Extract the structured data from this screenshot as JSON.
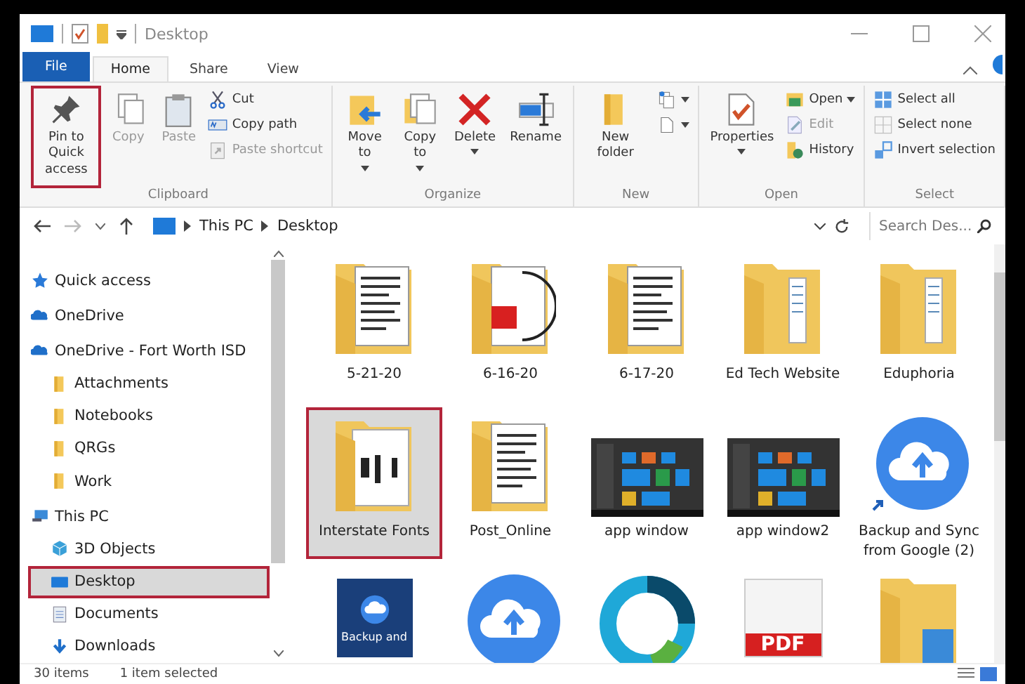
{
  "window": {
    "title": "Desktop"
  },
  "tabs": [
    {
      "label": "File",
      "kind": "file",
      "selected": false
    },
    {
      "label": "Home",
      "kind": "tab",
      "selected": true
    },
    {
      "label": "Share",
      "kind": "tab",
      "selected": false
    },
    {
      "label": "View",
      "kind": "tab",
      "selected": false
    }
  ],
  "ribbon": [
    {
      "label": "Clipboard",
      "items": [
        {
          "kind": "large",
          "label": "Pin to Quick access",
          "disabled": false,
          "outlined": true,
          "dropdown": false
        },
        {
          "kind": "large",
          "label": "Copy",
          "disabled": true,
          "outlined": false,
          "dropdown": false
        },
        {
          "kind": "large",
          "label": "Paste",
          "disabled": true,
          "outlined": false,
          "dropdown": false
        },
        {
          "kind": "stack",
          "entries": [
            {
              "label": "Cut",
              "disabled": false,
              "dropdown": false
            },
            {
              "label": "Copy path",
              "disabled": false,
              "dropdown": false
            },
            {
              "label": "Paste shortcut",
              "disabled": true,
              "dropdown": false
            }
          ]
        }
      ]
    },
    {
      "label": "Organize",
      "items": [
        {
          "kind": "large",
          "label": "Move to",
          "disabled": false,
          "outlined": false,
          "dropdown": true
        },
        {
          "kind": "large",
          "label": "Copy to",
          "disabled": false,
          "outlined": false,
          "dropdown": true
        },
        {
          "kind": "large",
          "label": "Delete",
          "disabled": false,
          "outlined": false,
          "dropdown": true
        },
        {
          "kind": "large",
          "label": "Rename",
          "disabled": false,
          "outlined": false,
          "dropdown": false
        }
      ]
    },
    {
      "label": "New",
      "items": [
        {
          "kind": "large",
          "label": "New folder",
          "disabled": false,
          "outlined": false,
          "dropdown": false
        },
        {
          "kind": "stack",
          "entries": [
            {
              "dropdown": true
            },
            {
              "dropdown": true
            }
          ]
        }
      ]
    },
    {
      "label": "Open",
      "items": [
        {
          "kind": "large",
          "label": "Properties",
          "disabled": false,
          "outlined": false,
          "dropdown": true
        },
        {
          "kind": "stack",
          "entries": [
            {
              "label": "Open",
              "disabled": false,
              "dropdown": true
            },
            {
              "label": "Edit",
              "disabled": true,
              "dropdown": false
            },
            {
              "label": "History",
              "disabled": false,
              "dropdown": false
            }
          ]
        }
      ]
    },
    {
      "label": "Select",
      "items": [
        {
          "kind": "stack",
          "entries": [
            {
              "label": "Select all",
              "disabled": false,
              "dropdown": false
            },
            {
              "label": "Select none",
              "disabled": false,
              "dropdown": false
            },
            {
              "label": "Invert selection",
              "disabled": false,
              "dropdown": false
            }
          ]
        }
      ]
    }
  ],
  "address": {
    "path": [
      "This PC",
      "Desktop"
    ],
    "search_placeholder": "Search Des..."
  },
  "navigation": [
    {
      "label": "Quick access",
      "kind": "star",
      "selected": false,
      "outlined": false
    },
    {
      "label": "OneDrive",
      "kind": "cloud",
      "selected": false,
      "outlined": false
    },
    {
      "label": "OneDrive - Fort Worth ISD",
      "kind": "cloud",
      "selected": false,
      "outlined": false,
      "children": [
        {
          "label": "Attachments",
          "kind": "folder",
          "selected": false,
          "outlined": false
        },
        {
          "label": "Notebooks",
          "kind": "folder",
          "selected": false,
          "outlined": false
        },
        {
          "label": "QRGs",
          "kind": "folder",
          "selected": false,
          "outlined": false
        },
        {
          "label": "Work",
          "kind": "folder",
          "selected": false,
          "outlined": false
        }
      ]
    },
    {
      "label": "This PC",
      "kind": "pc",
      "selected": false,
      "outlined": false,
      "children": [
        {
          "label": "3D Objects",
          "kind": "cube",
          "selected": false,
          "outlined": false
        },
        {
          "label": "Desktop",
          "kind": "desktop",
          "selected": true,
          "outlined": true
        },
        {
          "label": "Documents",
          "kind": "docs",
          "selected": false,
          "outlined": false
        },
        {
          "label": "Downloads",
          "kind": "download",
          "selected": false,
          "outlined": false
        }
      ]
    }
  ],
  "files": [
    {
      "name": "5-21-20",
      "kind": "docs",
      "selected": false,
      "outlined": false
    },
    {
      "name": "6-16-20",
      "kind": "pdfdocs",
      "selected": false,
      "outlined": false
    },
    {
      "name": "6-17-20",
      "kind": "docs",
      "selected": false,
      "outlined": false
    },
    {
      "name": "Ed Tech Website",
      "kind": "folder",
      "selected": false,
      "outlined": false
    },
    {
      "name": "Eduphoria",
      "kind": "folder",
      "selected": false,
      "outlined": false
    },
    {
      "name": "Interstate Fonts",
      "kind": "font",
      "selected": true,
      "outlined": true
    },
    {
      "name": "Post_Online",
      "kind": "docs",
      "selected": false,
      "outlined": false
    },
    {
      "name": "app window",
      "kind": "screenshot",
      "selected": false,
      "outlined": false
    },
    {
      "name": "app window2",
      "kind": "screenshot",
      "selected": false,
      "outlined": false
    },
    {
      "name": "Backup and Sync from Google (2)",
      "kind": "shortcut",
      "selected": false,
      "outlined": false
    },
    {
      "kind": "tile",
      "tile_text": "Backup and",
      "selected": false,
      "outlined": false
    },
    {
      "kind": "cloud",
      "selected": false,
      "outlined": false
    },
    {
      "kind": "ring",
      "selected": false,
      "outlined": false
    },
    {
      "kind": "pdf",
      "thumb_text": "PDF",
      "selected": false,
      "outlined": false
    },
    {
      "kind": "bluefolder",
      "selected": false,
      "outlined": false
    }
  ],
  "status_bar": {
    "count": "30 items",
    "selection": "1 item selected"
  }
}
